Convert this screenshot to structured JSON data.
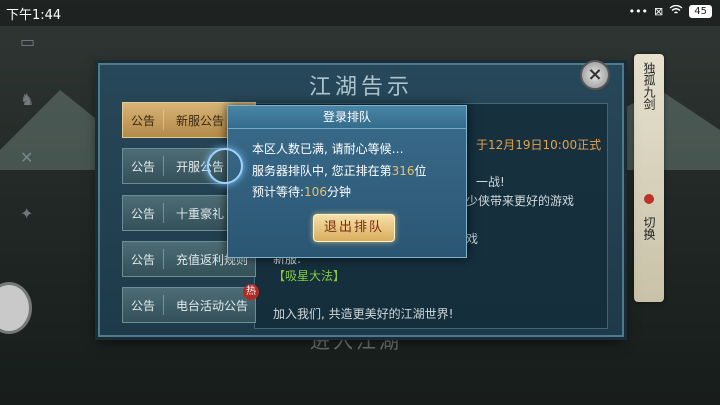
{
  "status_bar": {
    "time": "下午1:44",
    "battery": "45"
  },
  "board": {
    "title": "江湖告示",
    "close_symbol": "×"
  },
  "tabs": [
    {
      "tag": "公告",
      "label": "新服公告",
      "active": true
    },
    {
      "tag": "公告",
      "label": "开服公告"
    },
    {
      "tag": "公告",
      "label": "十重豪礼"
    },
    {
      "tag": "公告",
      "label": "充值返利规则"
    },
    {
      "tag": "公告",
      "label": "电台活动公告",
      "badge": "热"
    }
  ],
  "content": {
    "date_text": "于12月19日10:00正式",
    "line1": "一战!",
    "line2": "少侠带来更好的游戏",
    "line3": "戏",
    "new_server_label": "新服:",
    "new_server_name": "【吸星大法】",
    "join_text": "加入我们, 共造更美好的江湖世界!"
  },
  "side_tab": {
    "name": "独孤九剑",
    "switch": "切换"
  },
  "bottom_banner": "进入江湖",
  "dialog": {
    "title": "登录排队",
    "line1": "本区人数已满, 请耐心等候…",
    "line2_prefix": "服务器排队中, 您正排在第",
    "queue_position": "316",
    "line2_suffix": "位",
    "line3_prefix": "预计等待:",
    "wait_minutes": "106",
    "line3_suffix": "分钟",
    "exit_button": "退出排队"
  }
}
